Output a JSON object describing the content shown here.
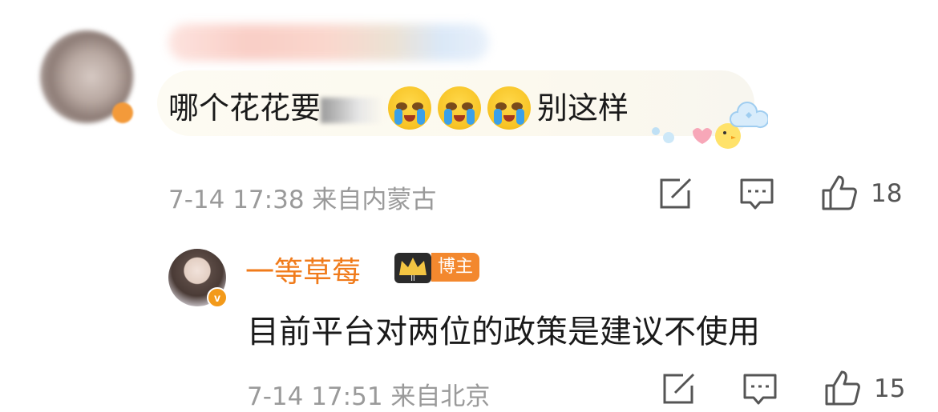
{
  "comment1": {
    "text_before": "哪个花花要",
    "emoji": [
      "crying-face",
      "crying-face",
      "crying-face"
    ],
    "text_after": "别这样",
    "time": "7-14 17:38",
    "location": "来自内蒙古",
    "like_count": "18"
  },
  "comment2": {
    "username": "一等草莓",
    "badge_label": "博主",
    "verified_badge": "v",
    "text": "目前平台对两位的政策是建议不使用",
    "time": "7-14 17:51",
    "location": "来自北京",
    "like_count": "15"
  },
  "colors": {
    "username": "#f07b1b",
    "badge": "#f3882e",
    "meta": "#9a9a9a"
  },
  "icons": [
    "share-icon",
    "comment-icon",
    "like-icon"
  ]
}
